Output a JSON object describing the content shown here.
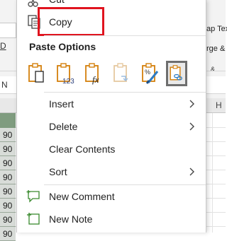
{
  "menu": {
    "cut_label": "Cut",
    "copy_label": "Copy",
    "paste_options_title": "Paste Options",
    "insert_label": "Insert",
    "delete_label": "Delete",
    "clear_contents_label": "Clear Contents",
    "sort_label": "Sort",
    "new_comment_label": "New Comment",
    "new_note_label": "New Note",
    "paste_icons": [
      "paste-icon",
      "paste-values-icon",
      "paste-formulas-icon",
      "paste-transpose-icon",
      "paste-formatting-icon",
      "paste-link-icon"
    ]
  },
  "background": {
    "ribbon_wrap_text": "ap Tex",
    "ribbon_merge": "rge &",
    "ribbon_amp": "&",
    "namebox_letter": "N",
    "formula_letter": "N",
    "underlined_d": "D",
    "column_h": "H",
    "row_values": [
      "90",
      "90",
      "90",
      "90",
      "90",
      "90",
      "90",
      "90"
    ]
  },
  "colors": {
    "highlight_red": "#e0141f",
    "accent_orange": "#d4800c",
    "accent_blue": "#2e7cc4",
    "comment_green": "#3a8a2e"
  }
}
